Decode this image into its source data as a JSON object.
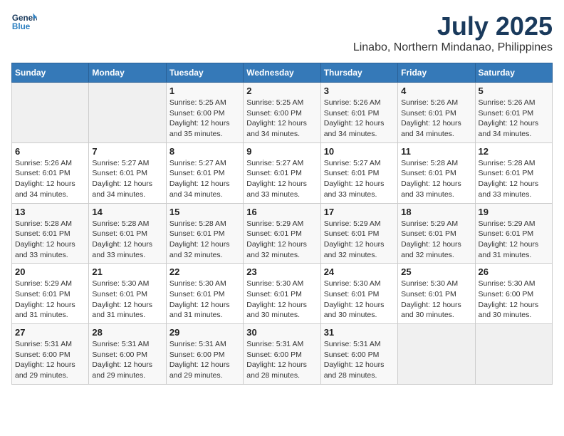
{
  "logo": {
    "line1": "General",
    "line2": "Blue"
  },
  "title": "July 2025",
  "subtitle": "Linabo, Northern Mindanao, Philippines",
  "weekdays": [
    "Sunday",
    "Monday",
    "Tuesday",
    "Wednesday",
    "Thursday",
    "Friday",
    "Saturday"
  ],
  "weeks": [
    [
      {
        "day": "",
        "detail": ""
      },
      {
        "day": "",
        "detail": ""
      },
      {
        "day": "1",
        "detail": "Sunrise: 5:25 AM\nSunset: 6:00 PM\nDaylight: 12 hours and 35 minutes."
      },
      {
        "day": "2",
        "detail": "Sunrise: 5:25 AM\nSunset: 6:00 PM\nDaylight: 12 hours and 34 minutes."
      },
      {
        "day": "3",
        "detail": "Sunrise: 5:26 AM\nSunset: 6:01 PM\nDaylight: 12 hours and 34 minutes."
      },
      {
        "day": "4",
        "detail": "Sunrise: 5:26 AM\nSunset: 6:01 PM\nDaylight: 12 hours and 34 minutes."
      },
      {
        "day": "5",
        "detail": "Sunrise: 5:26 AM\nSunset: 6:01 PM\nDaylight: 12 hours and 34 minutes."
      }
    ],
    [
      {
        "day": "6",
        "detail": "Sunrise: 5:26 AM\nSunset: 6:01 PM\nDaylight: 12 hours and 34 minutes."
      },
      {
        "day": "7",
        "detail": "Sunrise: 5:27 AM\nSunset: 6:01 PM\nDaylight: 12 hours and 34 minutes."
      },
      {
        "day": "8",
        "detail": "Sunrise: 5:27 AM\nSunset: 6:01 PM\nDaylight: 12 hours and 34 minutes."
      },
      {
        "day": "9",
        "detail": "Sunrise: 5:27 AM\nSunset: 6:01 PM\nDaylight: 12 hours and 33 minutes."
      },
      {
        "day": "10",
        "detail": "Sunrise: 5:27 AM\nSunset: 6:01 PM\nDaylight: 12 hours and 33 minutes."
      },
      {
        "day": "11",
        "detail": "Sunrise: 5:28 AM\nSunset: 6:01 PM\nDaylight: 12 hours and 33 minutes."
      },
      {
        "day": "12",
        "detail": "Sunrise: 5:28 AM\nSunset: 6:01 PM\nDaylight: 12 hours and 33 minutes."
      }
    ],
    [
      {
        "day": "13",
        "detail": "Sunrise: 5:28 AM\nSunset: 6:01 PM\nDaylight: 12 hours and 33 minutes."
      },
      {
        "day": "14",
        "detail": "Sunrise: 5:28 AM\nSunset: 6:01 PM\nDaylight: 12 hours and 33 minutes."
      },
      {
        "day": "15",
        "detail": "Sunrise: 5:28 AM\nSunset: 6:01 PM\nDaylight: 12 hours and 32 minutes."
      },
      {
        "day": "16",
        "detail": "Sunrise: 5:29 AM\nSunset: 6:01 PM\nDaylight: 12 hours and 32 minutes."
      },
      {
        "day": "17",
        "detail": "Sunrise: 5:29 AM\nSunset: 6:01 PM\nDaylight: 12 hours and 32 minutes."
      },
      {
        "day": "18",
        "detail": "Sunrise: 5:29 AM\nSunset: 6:01 PM\nDaylight: 12 hours and 32 minutes."
      },
      {
        "day": "19",
        "detail": "Sunrise: 5:29 AM\nSunset: 6:01 PM\nDaylight: 12 hours and 31 minutes."
      }
    ],
    [
      {
        "day": "20",
        "detail": "Sunrise: 5:29 AM\nSunset: 6:01 PM\nDaylight: 12 hours and 31 minutes."
      },
      {
        "day": "21",
        "detail": "Sunrise: 5:30 AM\nSunset: 6:01 PM\nDaylight: 12 hours and 31 minutes."
      },
      {
        "day": "22",
        "detail": "Sunrise: 5:30 AM\nSunset: 6:01 PM\nDaylight: 12 hours and 31 minutes."
      },
      {
        "day": "23",
        "detail": "Sunrise: 5:30 AM\nSunset: 6:01 PM\nDaylight: 12 hours and 30 minutes."
      },
      {
        "day": "24",
        "detail": "Sunrise: 5:30 AM\nSunset: 6:01 PM\nDaylight: 12 hours and 30 minutes."
      },
      {
        "day": "25",
        "detail": "Sunrise: 5:30 AM\nSunset: 6:01 PM\nDaylight: 12 hours and 30 minutes."
      },
      {
        "day": "26",
        "detail": "Sunrise: 5:30 AM\nSunset: 6:00 PM\nDaylight: 12 hours and 30 minutes."
      }
    ],
    [
      {
        "day": "27",
        "detail": "Sunrise: 5:31 AM\nSunset: 6:00 PM\nDaylight: 12 hours and 29 minutes."
      },
      {
        "day": "28",
        "detail": "Sunrise: 5:31 AM\nSunset: 6:00 PM\nDaylight: 12 hours and 29 minutes."
      },
      {
        "day": "29",
        "detail": "Sunrise: 5:31 AM\nSunset: 6:00 PM\nDaylight: 12 hours and 29 minutes."
      },
      {
        "day": "30",
        "detail": "Sunrise: 5:31 AM\nSunset: 6:00 PM\nDaylight: 12 hours and 28 minutes."
      },
      {
        "day": "31",
        "detail": "Sunrise: 5:31 AM\nSunset: 6:00 PM\nDaylight: 12 hours and 28 minutes."
      },
      {
        "day": "",
        "detail": ""
      },
      {
        "day": "",
        "detail": ""
      }
    ]
  ]
}
